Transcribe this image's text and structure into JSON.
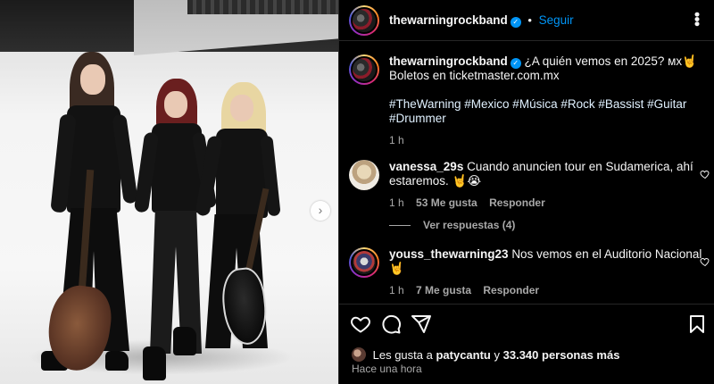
{
  "header": {
    "username": "thewarningrockband",
    "verified_glyph": "✓",
    "separator": "•",
    "follow_label": "Seguir",
    "more_glyph": "•••"
  },
  "caption": {
    "username": "thewarningrockband",
    "verified_glyph": "✓",
    "text_line1": "¿A quién vemos en 2025? мх🤘",
    "text_line2": "Boletos en ticketmaster.com.mx",
    "hashtags_line1": "#TheWarning #Mexico #Música #Rock #Bassist #Guitar",
    "hashtags_line2": "#Drummer",
    "time": "1 h"
  },
  "comments": [
    {
      "username": "vanessa_29s",
      "text_line1": "Cuando anuncien tour en Sudamerica, ahí",
      "text_line2": "estaremos. 🤘😭",
      "time": "1 h",
      "likes": "53 Me gusta",
      "reply": "Responder"
    },
    {
      "username": "youss_thewarning23",
      "text_line1": "Nos vemos en el Auditorio Nacional",
      "text_line2": "🤘",
      "time": "1 h",
      "likes": "7 Me gusta",
      "reply": "Responder"
    }
  ],
  "view_replies": "Ver respuestas (4)",
  "likes_summary": {
    "prefix": "Les gusta a",
    "user": "patycantu",
    "middle": "y",
    "others": "33.340 personas más"
  },
  "posted_time": "Hace una hora",
  "media": {
    "next_glyph": "›"
  },
  "icons": {
    "like": "heart-icon",
    "comment": "comment-icon",
    "share": "share-icon",
    "save": "bookmark-icon",
    "more": "more-icon",
    "next": "chevron-right-icon"
  },
  "colors": {
    "accent": "#0095f6",
    "background": "#000000",
    "muted": "#a8a8a8"
  }
}
